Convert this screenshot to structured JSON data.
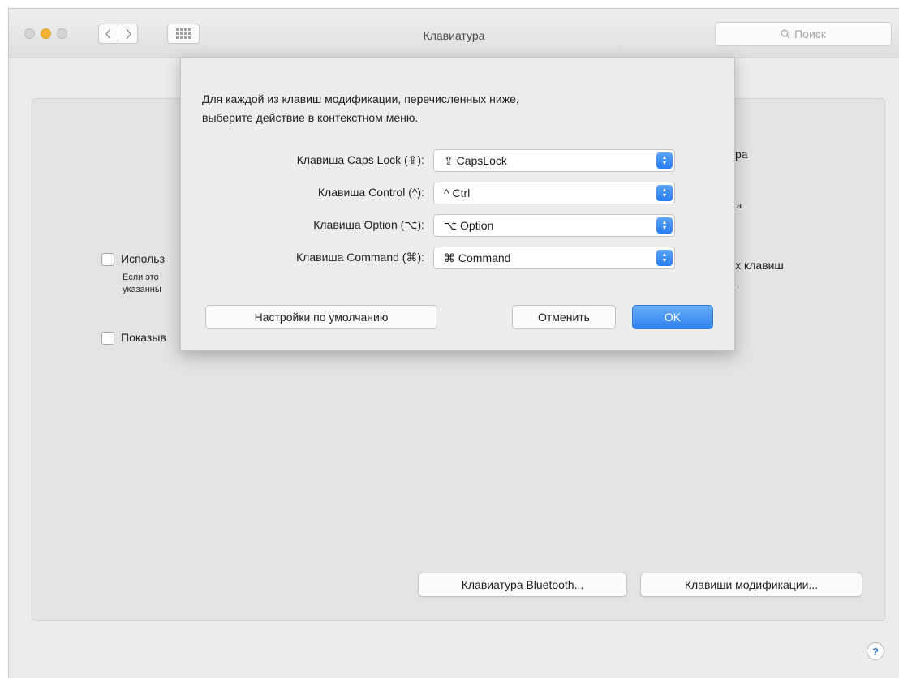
{
  "window": {
    "title": "Клавиатура",
    "search_placeholder": "Поиск"
  },
  "background": {
    "checkbox1_label": "Использ",
    "checkbox1_desc_line1": "Если это",
    "checkbox1_desc_line2": "указанны",
    "checkbox2_label": "Показыв",
    "right_fragment1": "ра",
    "right_fragment2": "а",
    "right_fragment3": "ых клавиш",
    "right_fragment4": ",",
    "bluetooth_button": "Клавиатура Bluetooth...",
    "modifier_button": "Клавиши модификации...",
    "help_label": "?"
  },
  "sheet": {
    "instruction_line1": "Для каждой из клавиш модификации, перечисленных ниже,",
    "instruction_line2": "выберите действие в контекстном меню.",
    "rows": [
      {
        "label": "Клавиша Caps Lock (⇪):",
        "value": "⇪ CapsLock"
      },
      {
        "label": "Клавиша Control (^):",
        "value": "^ Ctrl"
      },
      {
        "label": "Клавиша Option (⌥):",
        "value": "⌥ Option"
      },
      {
        "label": "Клавиша Command (⌘):",
        "value": "⌘ Command"
      }
    ],
    "defaults_button": "Настройки по умолчанию",
    "cancel_button": "Отменить",
    "ok_button": "OK"
  },
  "colors": {
    "accent": "#2e82f0",
    "minimize": "#f5b234"
  }
}
